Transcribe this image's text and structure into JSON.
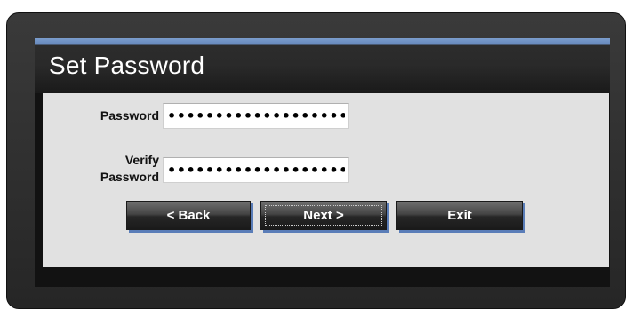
{
  "dialog": {
    "title": "Set Password"
  },
  "form": {
    "password_label": "Password",
    "password_value": "•••••••••••••••••••",
    "verify_label_line1": "Verify",
    "verify_label_line2": "Password",
    "verify_value": "•••••••••••••••••••"
  },
  "buttons": {
    "back_label": "< Back",
    "next_label": "Next >",
    "exit_label": "Exit"
  },
  "colors": {
    "title_accent": "#6688bb",
    "button_shadow": "#5a7db8",
    "content_bg": "#e1e1e1"
  }
}
